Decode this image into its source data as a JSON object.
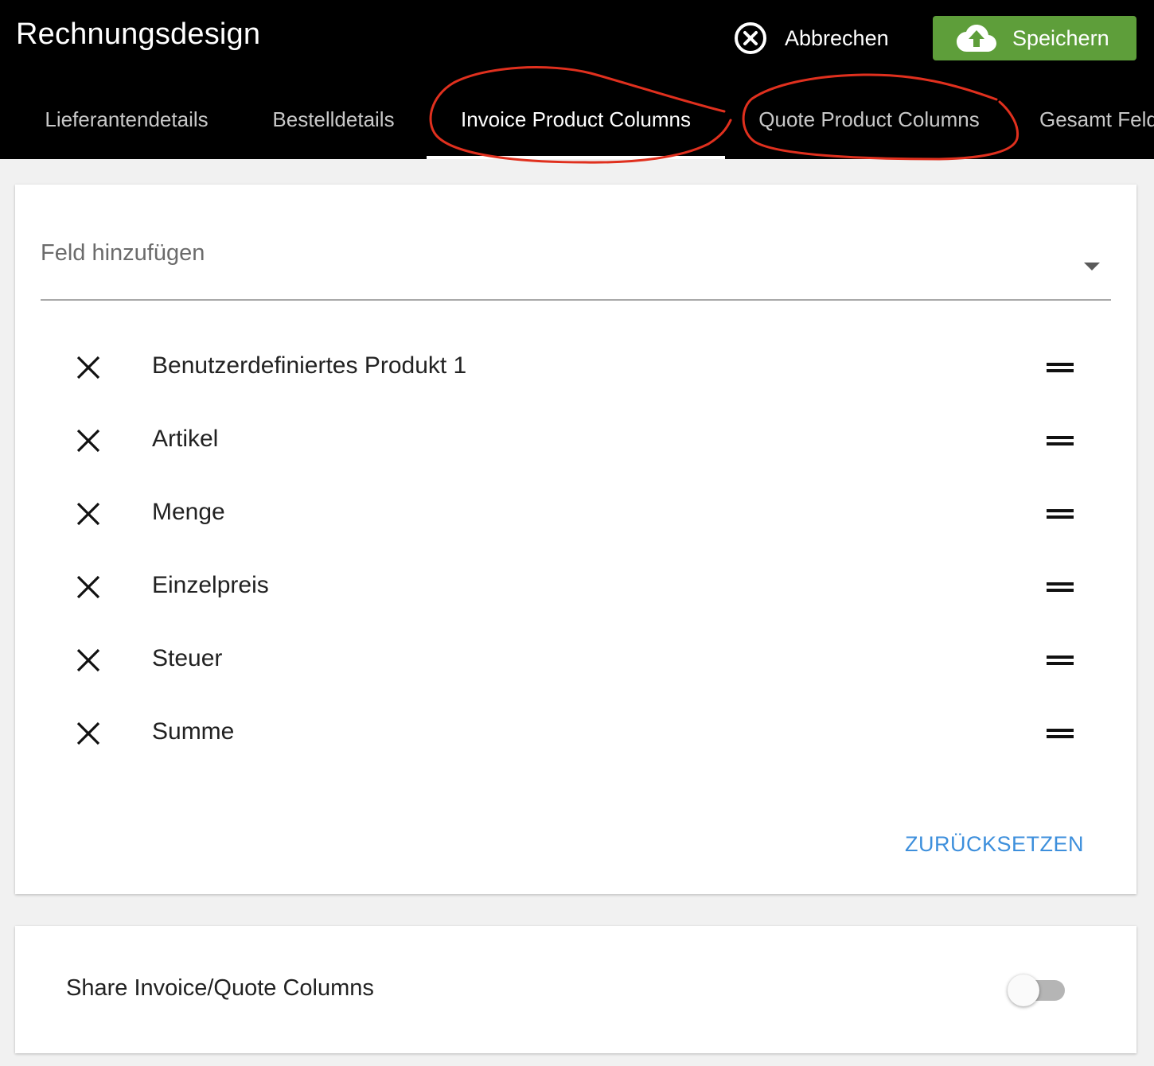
{
  "header": {
    "title": "Rechnungsdesign",
    "cancel_label": "Abbrechen",
    "save_label": "Speichern"
  },
  "tabs": [
    {
      "label": "Lieferantendetails",
      "active": false
    },
    {
      "label": "Bestelldetails",
      "active": false
    },
    {
      "label": "Invoice Product Columns",
      "active": true
    },
    {
      "label": "Quote Product Columns",
      "active": false
    },
    {
      "label": "Gesamt Felder",
      "active": false
    }
  ],
  "main": {
    "dropdown_label": "Feld hinzufügen",
    "fields": [
      {
        "label": "Benutzerdefiniertes Produkt 1"
      },
      {
        "label": "Artikel"
      },
      {
        "label": "Menge"
      },
      {
        "label": "Einzelpreis"
      },
      {
        "label": "Steuer"
      },
      {
        "label": "Summe"
      }
    ],
    "reset_label": "ZURÜCKSETZEN"
  },
  "share": {
    "label": "Share Invoice/Quote Columns",
    "enabled": false
  },
  "colors": {
    "header_bg": "#000000",
    "save_green": "#5e9e3a",
    "link_blue": "#3d8fdc",
    "annotation_red": "#e0301e"
  },
  "icons": {
    "cancel": "close-circle-icon",
    "save": "cloud-upload-icon",
    "remove": "close-icon",
    "drag": "drag-handle-icon",
    "dropdown": "caret-down-icon"
  }
}
